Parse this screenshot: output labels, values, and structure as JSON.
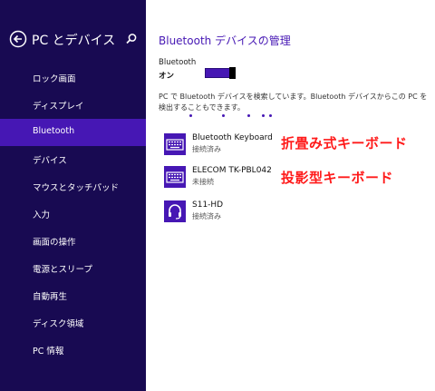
{
  "sidebar": {
    "title": "PC とデバイス",
    "back_icon": "back-arrow-icon",
    "search_icon": "search-icon",
    "items": [
      {
        "label": "ロック画面"
      },
      {
        "label": "ディスプレイ"
      },
      {
        "label": "Bluetooth",
        "selected": true
      },
      {
        "label": "デバイス"
      },
      {
        "label": "マウスとタッチパッド"
      },
      {
        "label": "入力"
      },
      {
        "label": "画面の操作"
      },
      {
        "label": "電源とスリープ"
      },
      {
        "label": "自動再生"
      },
      {
        "label": "ディスク領域"
      },
      {
        "label": "PC 情報"
      }
    ]
  },
  "main": {
    "title": "Bluetooth デバイスの管理",
    "bluetooth_label": "Bluetooth",
    "toggle_state": "オン",
    "toggle_on": true,
    "status_text": "PC で Bluetooth デバイスを検索しています。Bluetooth デバイスからこの PC を検出することもできます。",
    "devices": [
      {
        "name": "Bluetooth Keyboard",
        "status": "接続済み",
        "icon": "keyboard-icon"
      },
      {
        "name": "ELECOM TK-PBL042",
        "status": "未接続",
        "icon": "keyboard-icon"
      },
      {
        "name": "S11-HD",
        "status": "接続済み",
        "icon": "headset-icon"
      }
    ]
  },
  "annotations": {
    "folding_keyboard": "折畳み式キーボード",
    "projection_keyboard": "投影型キーボード"
  },
  "colors": {
    "sidebar_bg": "#180a52",
    "accent": "#4617b4",
    "annotation": "#ff1a1a"
  }
}
